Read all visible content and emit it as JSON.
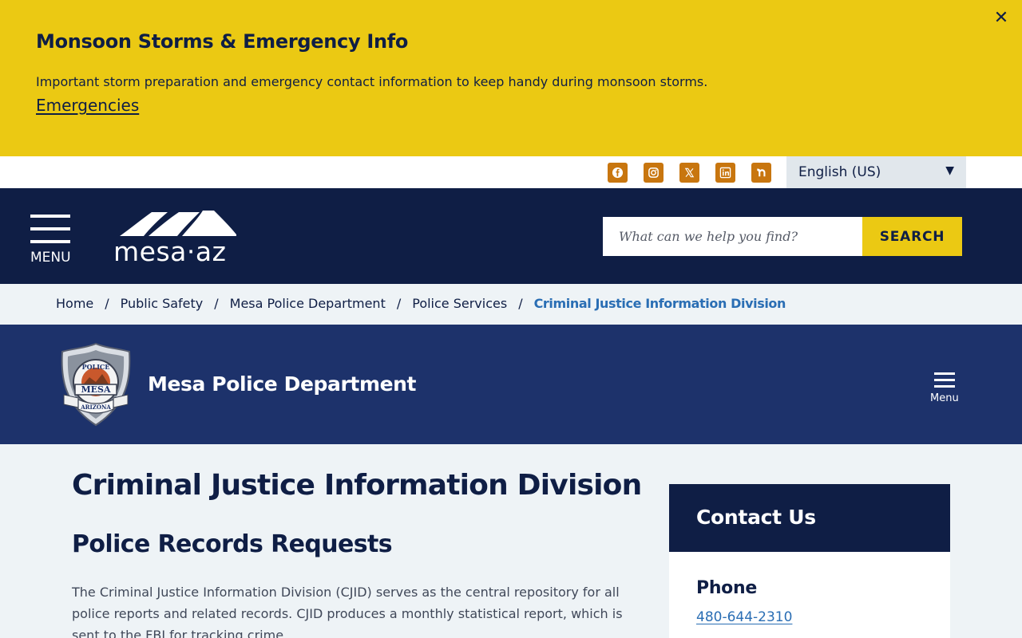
{
  "alert": {
    "title": "Monsoon Storms & Emergency Info",
    "text": "Important storm preparation and emergency contact information to keep handy during monsoon storms.",
    "link": "Emergencies",
    "close_icon": "close-icon"
  },
  "utility": {
    "social_icons": [
      "facebook-icon",
      "instagram-icon",
      "x-icon",
      "linkedin-icon",
      "nextdoor-icon"
    ],
    "language": "English (US)"
  },
  "header": {
    "menu_label": "MENU",
    "logo_text": "mesa·az",
    "search_placeholder": "What can we help you find?",
    "search_button": "SEARCH"
  },
  "breadcrumb": {
    "items": [
      "Home",
      "Public Safety",
      "Mesa Police Department",
      "Police Services"
    ],
    "current": "Criminal Justice Information Division",
    "separator": "/"
  },
  "department": {
    "title": "Mesa Police Department",
    "menu_label": "Menu",
    "badge_text": [
      "POLICE",
      "MESA",
      "ARIZONA"
    ]
  },
  "main": {
    "title": "Criminal Justice Information Division",
    "subtitle": "Police Records Requests",
    "paragraph": "The Criminal Justice Information Division (CJID) serves as the central repository for all police reports and related records. CJID produces a monthly statistical report, which is sent to the FBI for tracking crime."
  },
  "sidebar": {
    "contact_title": "Contact Us",
    "phone_label": "Phone",
    "phone_number": "480-644-2310"
  },
  "colors": {
    "navy": "#0f1e45",
    "banner_blue": "#1d326b",
    "alert_yellow": "#ebc913",
    "social_orange": "#c8760f",
    "link_blue": "#2a6eb4"
  }
}
